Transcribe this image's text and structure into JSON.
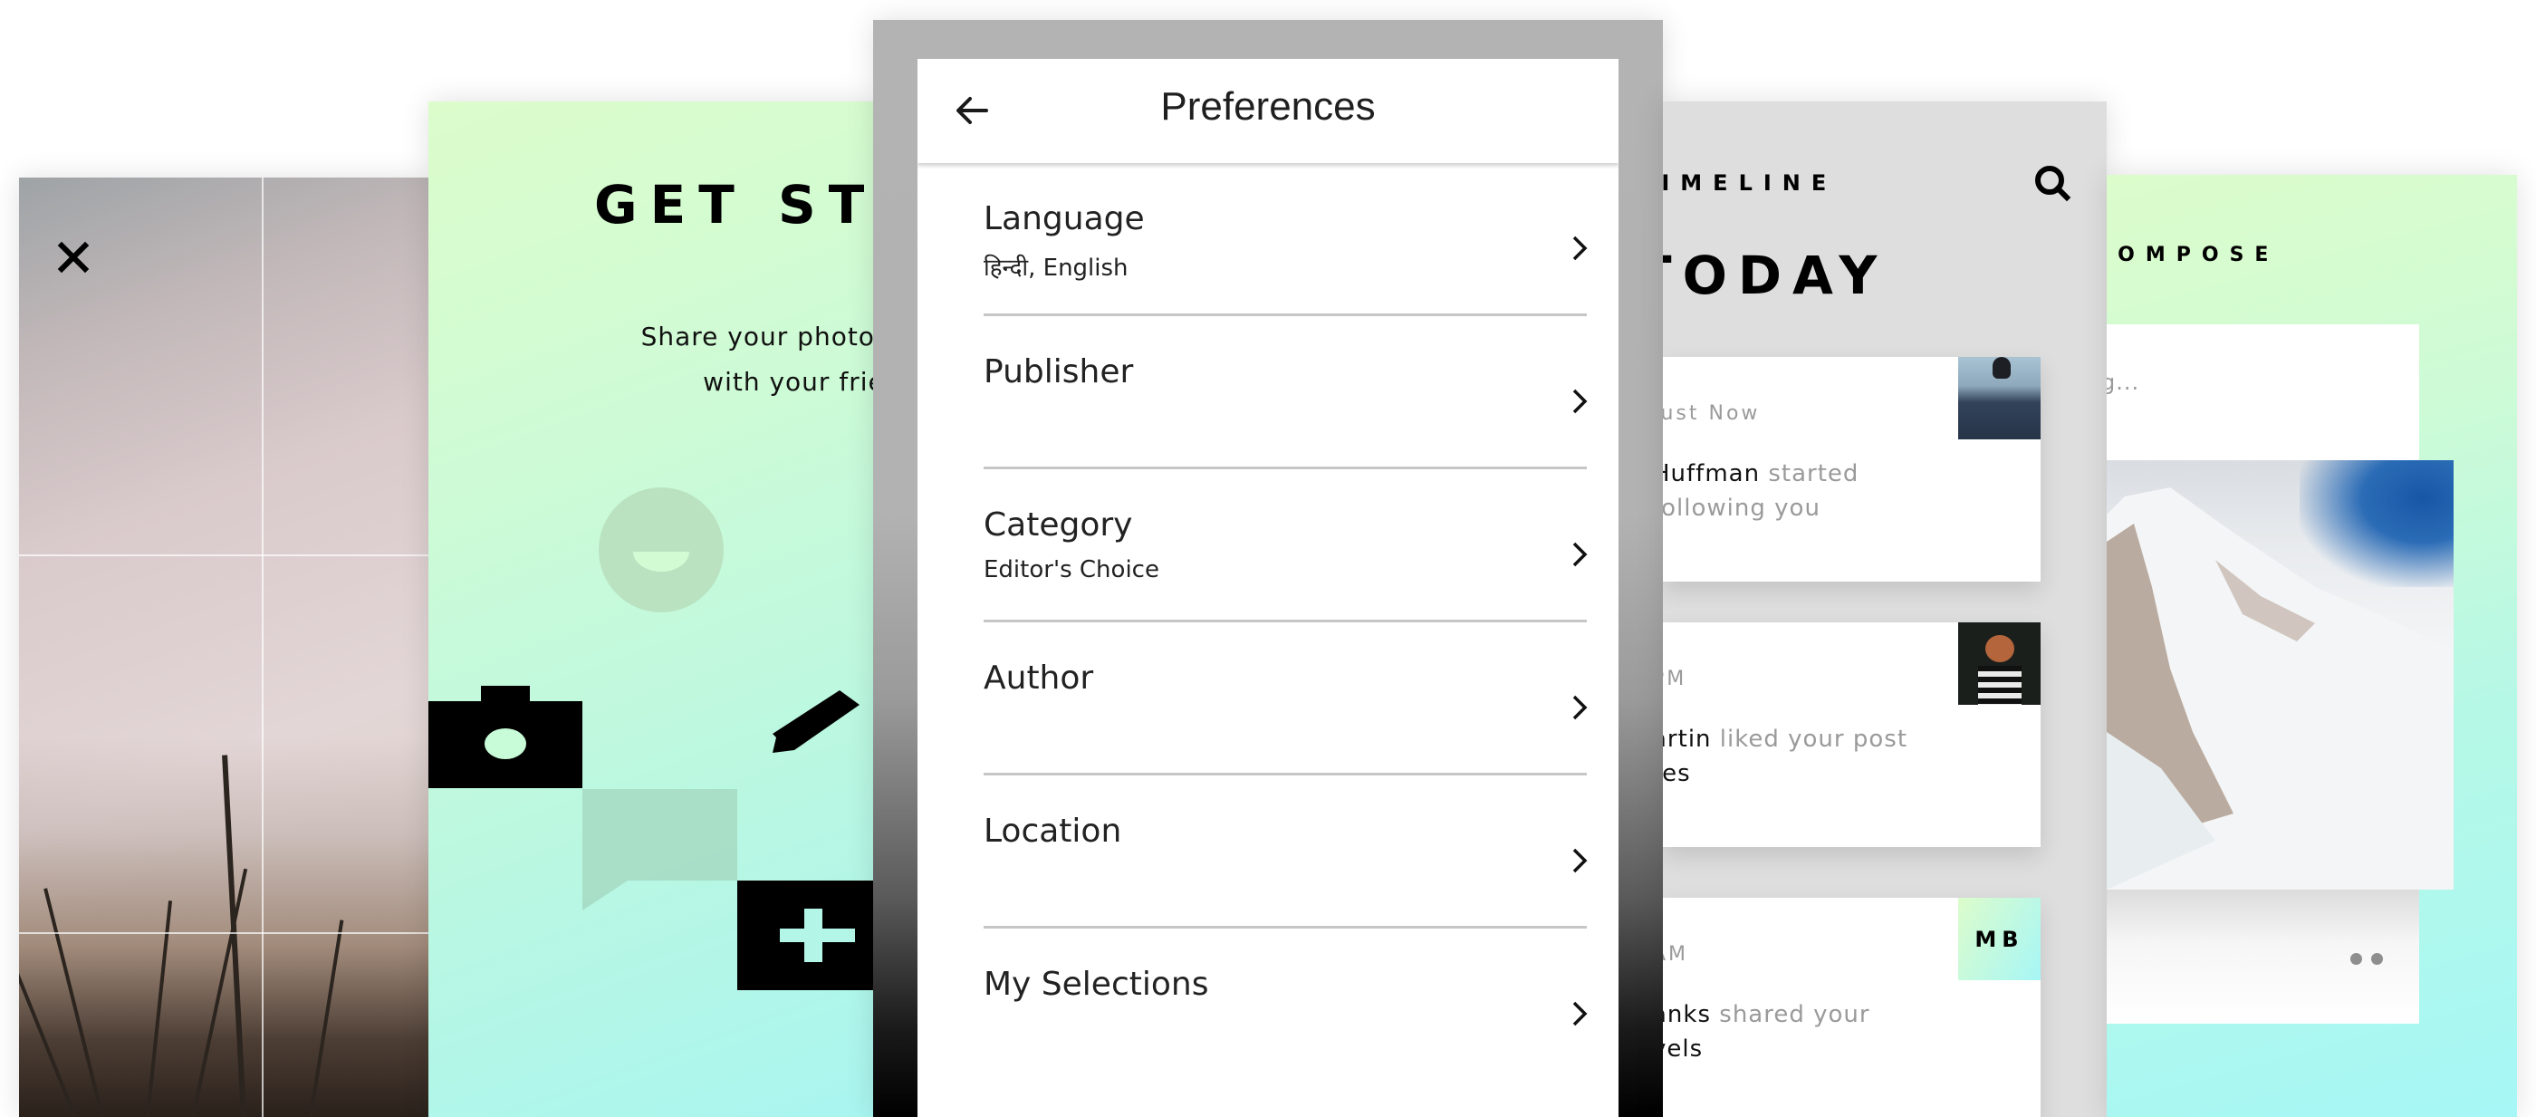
{
  "crop_screen": {
    "close_icon": "close-icon"
  },
  "get_started": {
    "title": "GET STARTED",
    "subtitle": "Share your photos, videos\nwith your friends",
    "icons": [
      "smiley-icon",
      "camera-icon",
      "pencil-icon",
      "chat-bubble-icon",
      "plus-icon"
    ]
  },
  "preferences": {
    "back_icon": "arrow-left-icon",
    "title": "Preferences",
    "items": [
      {
        "label": "Language",
        "value": "हिन्दी, English"
      },
      {
        "label": "Publisher",
        "value": ""
      },
      {
        "label": "Category",
        "value": "Editor's Choice"
      },
      {
        "label": "Author",
        "value": ""
      },
      {
        "label": "Location",
        "value": ""
      },
      {
        "label": "My Selections",
        "value": ""
      }
    ]
  },
  "timeline": {
    "header": "TIMELINE",
    "search_icon": "search-icon",
    "section": "TODAY",
    "cards": [
      {
        "time": "Just Now",
        "who": "Huffman",
        "action": " started following you",
        "object": "",
        "thumb": "photo"
      },
      {
        "time": "PM",
        "who": "artin",
        "action": " liked your post",
        "object": "res",
        "thumb": "photo"
      },
      {
        "time": "AM",
        "who": "anks",
        "action": " shared your",
        "object": "vels",
        "initials": "MB"
      }
    ]
  },
  "compose": {
    "header": "COMPOSE",
    "input_placeholder": "g...",
    "pager_dots": 2
  }
}
